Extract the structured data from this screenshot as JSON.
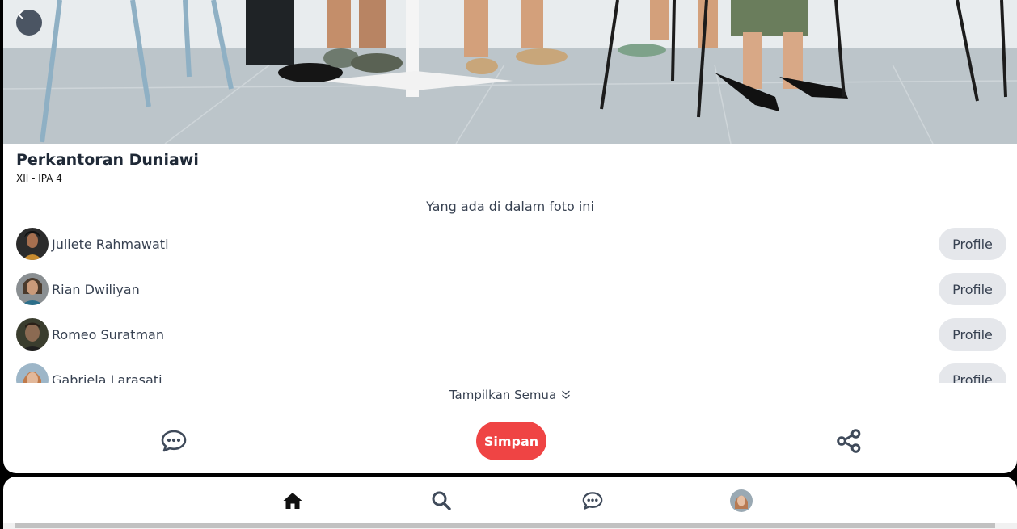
{
  "post": {
    "title": "Perkantoran Duniawi",
    "class": "XII - IPA 4"
  },
  "tagged": {
    "heading": "Yang ada di dalam foto ini",
    "people": [
      {
        "name": "Juliete Rahmawati",
        "action": "Profile"
      },
      {
        "name": "Rian Dwiliyan",
        "action": "Profile"
      },
      {
        "name": "Romeo Suratman",
        "action": "Profile"
      },
      {
        "name": "Gabriela Larasati",
        "action": "Profile"
      }
    ],
    "show_all": "Tampilkan Semua"
  },
  "actions": {
    "save": "Simpan"
  },
  "icons": {
    "back": "chevron-left-icon",
    "comment": "comment-dots-icon",
    "share": "share-nodes-icon",
    "show_all": "double-chevron-down-icon",
    "nav": [
      "home-icon",
      "search-icon",
      "comment-dots-icon",
      "avatar"
    ]
  },
  "colors": {
    "accent": "#ef4444",
    "pill": "#e5e7eb",
    "text": "#374151"
  }
}
